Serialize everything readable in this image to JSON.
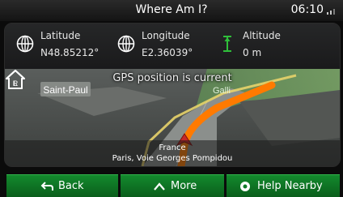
{
  "header": {
    "title": "Where Am I?",
    "time": "06:10"
  },
  "coordinates": {
    "latitude": {
      "label": "Latitude",
      "value": "N48.85212°"
    },
    "longitude": {
      "label": "Longitude",
      "value": "E2.36039°"
    },
    "altitude": {
      "label": "Altitude",
      "value": "0 m"
    }
  },
  "map": {
    "gps_status": "GPS position is current",
    "street_labels": [
      "Saint-Paul",
      "Galli"
    ],
    "country": "France",
    "address": "Paris, Voie Georges Pompidou"
  },
  "buttons": {
    "back": "Back",
    "more": "More",
    "help": "Help Nearby"
  },
  "colors": {
    "button_green": "#0f7a27",
    "route_orange": "#ff7a00",
    "altitude_green": "#2fbf3a"
  },
  "icons": [
    "signal-icon",
    "globe-icon",
    "altitude-icon",
    "home-icon",
    "back-arrow-icon",
    "chevron-up-icon",
    "help-nearby-icon",
    "position-arrow-icon"
  ]
}
